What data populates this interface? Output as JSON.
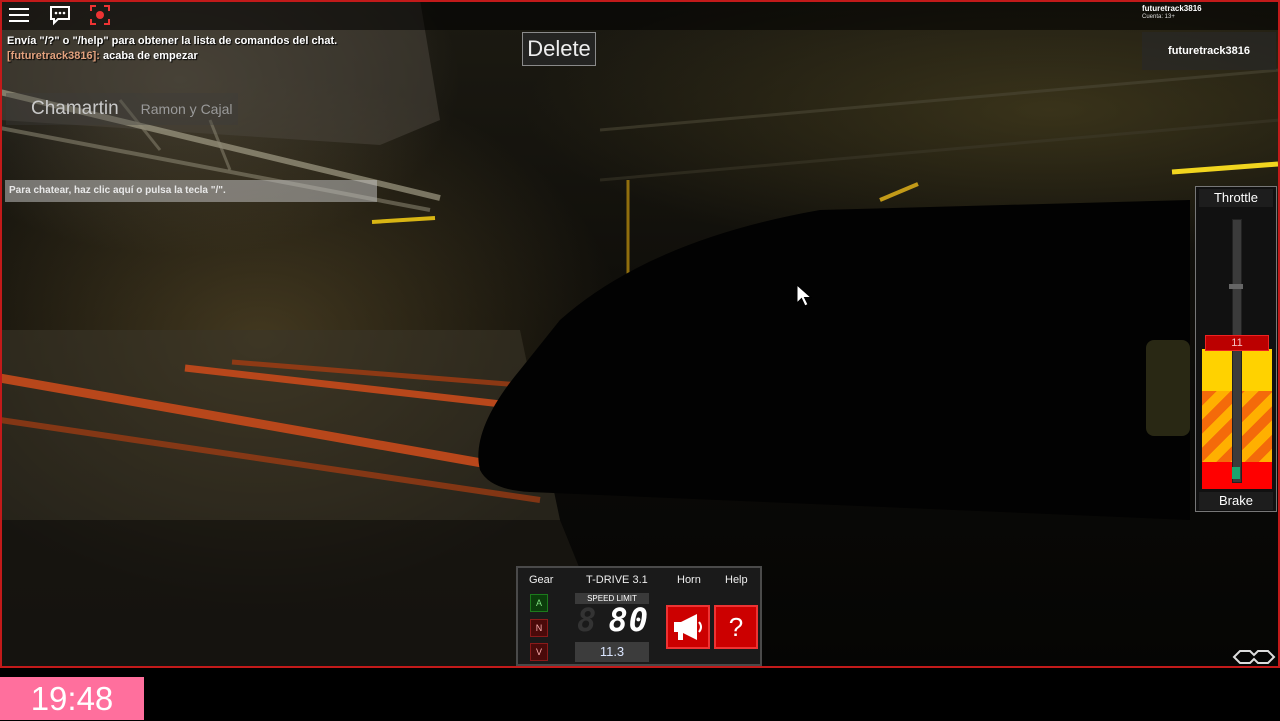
{
  "topbar": {
    "icons": [
      "menu-icon",
      "chat-icon",
      "record-icon"
    ],
    "username": "futuretrack3816",
    "account": "Cuenta: 13+"
  },
  "chat": {
    "lines": [
      {
        "who": "",
        "text": "Envía \"/?\" o \"/help\" para obtener la lista de comandos del chat."
      },
      {
        "who": "[futuretrack3816]:",
        "text": " acaba de empezar"
      }
    ],
    "input_placeholder": "Para chatear, haz clic aquí o pulsa la tecla \"/\"."
  },
  "delete_label": "Delete",
  "stations": {
    "current": "Chamartin",
    "next": "Ramon y Cajal"
  },
  "player_list": {
    "name": "futuretrack3816"
  },
  "throttle": {
    "top_label": "Throttle",
    "bottom_label": "Brake",
    "value": "11",
    "colors": {
      "handle": "#bb0000",
      "zone": "#ffd200",
      "brake": "#ff0000"
    }
  },
  "hud": {
    "gear_header": "Gear",
    "title": "T-DRIVE 3.1",
    "horn_header": "Horn",
    "help_header": "Help",
    "gears": [
      "A",
      "N",
      "V"
    ],
    "active_gear": "A",
    "speed_limit_label": "SPEED LIMIT",
    "speed_limit_value": "80",
    "speed_readout": "11.3",
    "horn_icon": "megaphone-icon",
    "help_icon": "?"
  },
  "clock": "19:48"
}
